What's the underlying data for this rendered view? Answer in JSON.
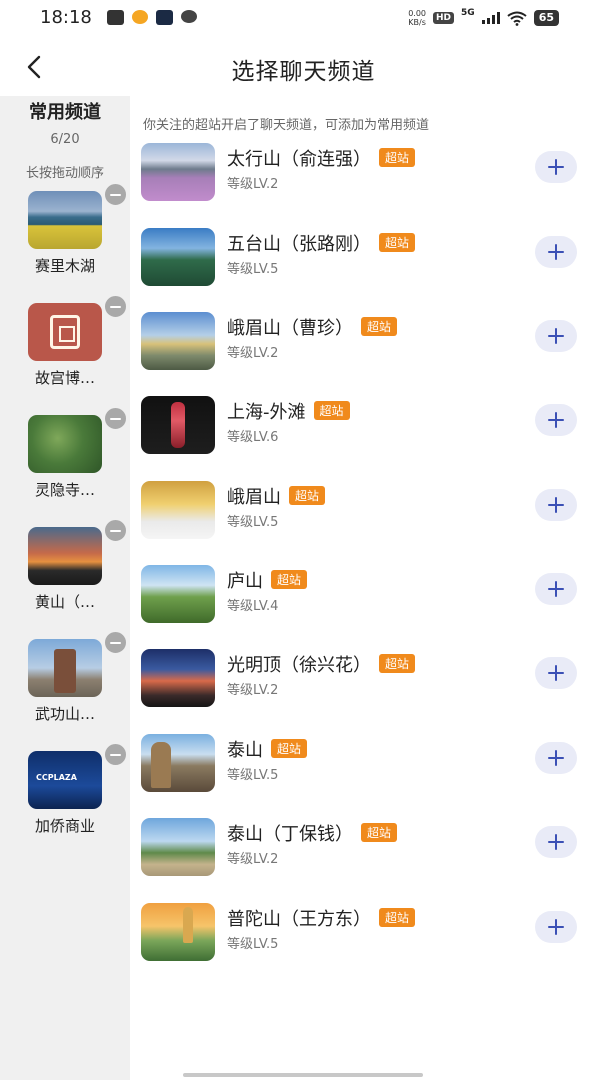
{
  "status_bar": {
    "time": "18:18",
    "net_speed_value": "0.00",
    "net_speed_unit": "KB/s",
    "hd": "HD",
    "network": "5G",
    "battery": "65"
  },
  "header": {
    "back_icon": "chevron-left-icon",
    "title": "选择聊天频道"
  },
  "sidebar": {
    "title": "常用频道",
    "count": "6/20",
    "hint": "长按拖动顺序",
    "items": [
      {
        "label": "赛里木湖"
      },
      {
        "label": "故宫博…"
      },
      {
        "label": "灵隐寺…"
      },
      {
        "label": "黄山（…"
      },
      {
        "label": "武功山…"
      },
      {
        "label": "加侨商业"
      }
    ]
  },
  "main": {
    "hint": "你关注的超站开启了聊天频道，可添加为常用频道",
    "badge_color": "#f08a1c",
    "add_button_color": "#3b50b5",
    "channels": [
      {
        "name": "太行山（俞连强）",
        "badge": "超站",
        "level": "等级LV.2"
      },
      {
        "name": "五台山（张路刚）",
        "badge": "超站",
        "level": "等级LV.5"
      },
      {
        "name": "峨眉山（曹珍）",
        "badge": "超站",
        "level": "等级LV.2"
      },
      {
        "name": "上海-外滩",
        "badge": "超站",
        "level": "等级LV.6"
      },
      {
        "name": "峨眉山",
        "badge": "超站",
        "level": "等级LV.5"
      },
      {
        "name": "庐山",
        "badge": "超站",
        "level": "等级LV.4"
      },
      {
        "name": "光明顶（徐兴花）",
        "badge": "超站",
        "level": "等级LV.2"
      },
      {
        "name": "泰山",
        "badge": "超站",
        "level": "等级LV.5"
      },
      {
        "name": "泰山（丁保钱）",
        "badge": "超站",
        "level": "等级LV.2"
      },
      {
        "name": "普陀山（王方东）",
        "badge": "超站",
        "level": "等级LV.5"
      }
    ]
  }
}
